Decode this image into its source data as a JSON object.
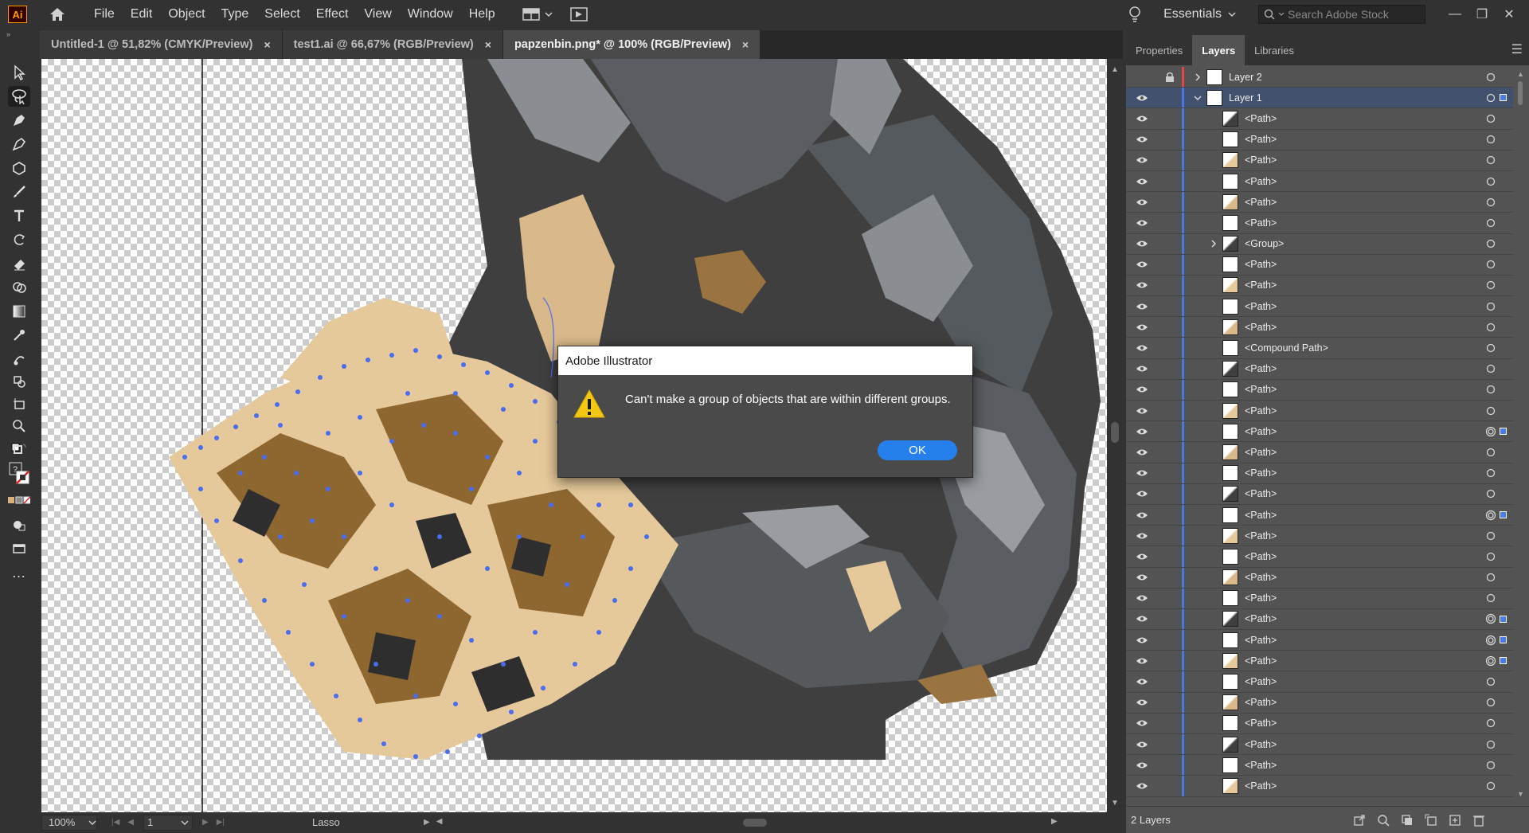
{
  "app": {
    "logo": "Ai"
  },
  "menu": [
    "File",
    "Edit",
    "Object",
    "Type",
    "Select",
    "Effect",
    "View",
    "Window",
    "Help"
  ],
  "workspace": {
    "label": "Essentials",
    "search_placeholder": "Search Adobe Stock"
  },
  "tabs": [
    {
      "label": "Untitled-1 @ 51,82% (CMYK/Preview)",
      "close": "×"
    },
    {
      "label": "test1.ai @ 66,67% (RGB/Preview)",
      "close": "×"
    },
    {
      "label": "papzenbin.png* @ 100% (RGB/Preview)",
      "close": "×"
    }
  ],
  "dialog": {
    "title": "Adobe Illustrator",
    "message": "Can't make a group of objects that are within different groups.",
    "ok": "OK"
  },
  "status": {
    "zoom": "100%",
    "artboard": "1",
    "tool": "Lasso"
  },
  "panel": {
    "tabs": [
      "Properties",
      "Layers",
      "Libraries"
    ],
    "active_tab": "Layers",
    "footer": "2 Layers",
    "layers": [
      {
        "name": "Layer 2",
        "level": 0,
        "expand": "collapsed",
        "eye": false,
        "lock": true,
        "color": "#e04848",
        "selected": false,
        "sel": false
      },
      {
        "name": "Layer 1",
        "level": 0,
        "expand": "expanded",
        "eye": true,
        "lock": false,
        "color": "#4878e0",
        "selected": true,
        "sel": true
      },
      {
        "name": "<Path>",
        "level": 1,
        "eye": true,
        "color": "#4878e0"
      },
      {
        "name": "<Path>",
        "level": 1,
        "eye": true,
        "color": "#4878e0"
      },
      {
        "name": "<Path>",
        "level": 1,
        "eye": true,
        "color": "#4878e0"
      },
      {
        "name": "<Path>",
        "level": 1,
        "eye": true,
        "color": "#4878e0"
      },
      {
        "name": "<Path>",
        "level": 1,
        "eye": true,
        "color": "#4878e0"
      },
      {
        "name": "<Path>",
        "level": 1,
        "eye": true,
        "color": "#4878e0"
      },
      {
        "name": "<Group>",
        "level": 1,
        "expand": "collapsed",
        "eye": true,
        "color": "#4878e0"
      },
      {
        "name": "<Path>",
        "level": 1,
        "eye": true,
        "color": "#4878e0"
      },
      {
        "name": "<Path>",
        "level": 1,
        "eye": true,
        "color": "#4878e0"
      },
      {
        "name": "<Path>",
        "level": 1,
        "eye": true,
        "color": "#4878e0"
      },
      {
        "name": "<Path>",
        "level": 1,
        "eye": true,
        "color": "#4878e0"
      },
      {
        "name": "<Compound Path>",
        "level": 1,
        "eye": true,
        "color": "#4878e0"
      },
      {
        "name": "<Path>",
        "level": 1,
        "eye": true,
        "color": "#4878e0"
      },
      {
        "name": "<Path>",
        "level": 1,
        "eye": true,
        "color": "#4878e0"
      },
      {
        "name": "<Path>",
        "level": 1,
        "eye": true,
        "color": "#4878e0"
      },
      {
        "name": "<Path>",
        "level": 1,
        "eye": true,
        "color": "#4878e0",
        "sel": true
      },
      {
        "name": "<Path>",
        "level": 1,
        "eye": true,
        "color": "#4878e0"
      },
      {
        "name": "<Path>",
        "level": 1,
        "eye": true,
        "color": "#4878e0"
      },
      {
        "name": "<Path>",
        "level": 1,
        "eye": true,
        "color": "#4878e0"
      },
      {
        "name": "<Path>",
        "level": 1,
        "eye": true,
        "color": "#4878e0",
        "sel": true
      },
      {
        "name": "<Path>",
        "level": 1,
        "eye": true,
        "color": "#4878e0"
      },
      {
        "name": "<Path>",
        "level": 1,
        "eye": true,
        "color": "#4878e0"
      },
      {
        "name": "<Path>",
        "level": 1,
        "eye": true,
        "color": "#4878e0"
      },
      {
        "name": "<Path>",
        "level": 1,
        "eye": true,
        "color": "#4878e0"
      },
      {
        "name": "<Path>",
        "level": 1,
        "eye": true,
        "color": "#4878e0",
        "sel": true
      },
      {
        "name": "<Path>",
        "level": 1,
        "eye": true,
        "color": "#4878e0",
        "sel": true
      },
      {
        "name": "<Path>",
        "level": 1,
        "eye": true,
        "color": "#4878e0",
        "sel": true
      },
      {
        "name": "<Path>",
        "level": 1,
        "eye": true,
        "color": "#4878e0"
      },
      {
        "name": "<Path>",
        "level": 1,
        "eye": true,
        "color": "#4878e0"
      },
      {
        "name": "<Path>",
        "level": 1,
        "eye": true,
        "color": "#4878e0"
      },
      {
        "name": "<Path>",
        "level": 1,
        "eye": true,
        "color": "#4878e0"
      },
      {
        "name": "<Path>",
        "level": 1,
        "eye": true,
        "color": "#4878e0"
      },
      {
        "name": "<Path>",
        "level": 1,
        "eye": true,
        "color": "#4878e0"
      }
    ]
  }
}
